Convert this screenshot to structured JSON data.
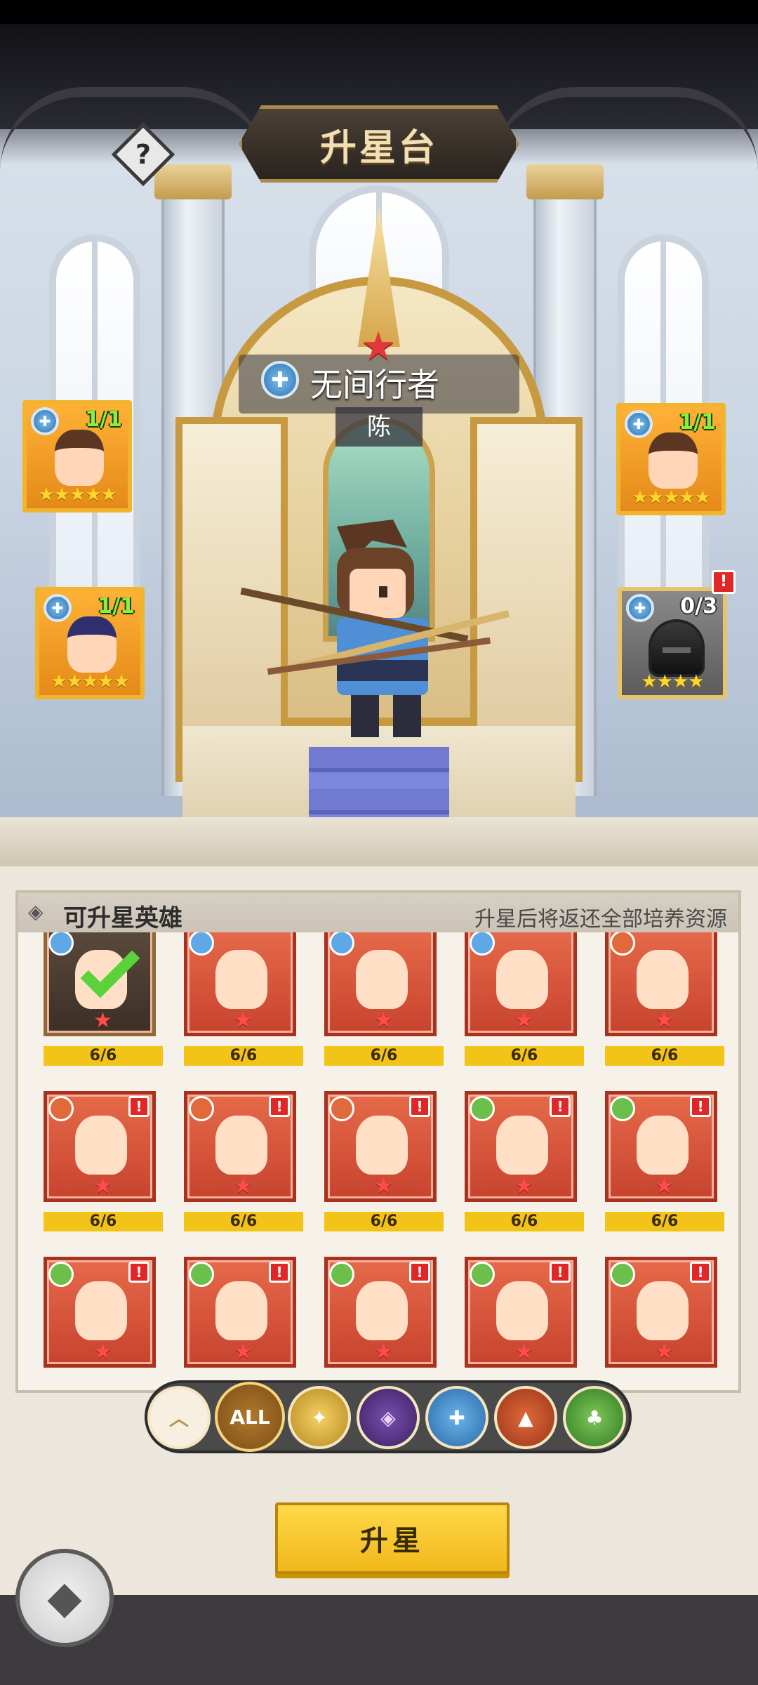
{
  "header": {
    "title": "升星台",
    "help_label": "?"
  },
  "hero": {
    "name": "无间行者",
    "subtitle": "陈",
    "faction_icon": "blue-shield-faction-icon"
  },
  "slots": [
    {
      "count": "1/1",
      "stars": "★★★★★"
    },
    {
      "count": "1/1",
      "stars": "★★★★★"
    },
    {
      "count": "1/1",
      "stars": "★★★★★"
    },
    {
      "count": "0/3",
      "stars": "★★★★",
      "alert": "!"
    }
  ],
  "list": {
    "title": "可升星英雄",
    "note": "升星后将返还全部培养资源",
    "heroes": [
      {
        "progress": "6/6",
        "selected": true
      },
      {
        "progress": "6/6"
      },
      {
        "progress": "6/6"
      },
      {
        "progress": "6/6"
      },
      {
        "progress": "6/6"
      },
      {
        "progress": "6/6",
        "alert": "!"
      },
      {
        "progress": "6/6",
        "alert": "!"
      },
      {
        "progress": "6/6",
        "alert": "!"
      },
      {
        "progress": "6/6",
        "alert": "!"
      },
      {
        "progress": "6/6",
        "alert": "!"
      },
      {
        "progress": "",
        "alert": "!"
      },
      {
        "progress": "",
        "alert": "!"
      },
      {
        "progress": "",
        "alert": "!"
      },
      {
        "progress": "",
        "alert": "!"
      },
      {
        "progress": "",
        "alert": "!"
      }
    ]
  },
  "filters": {
    "collapse": "︿",
    "all": "ALL",
    "gold": "✦",
    "purple": "◈",
    "blue": "✚",
    "red": "▲",
    "green": "♣"
  },
  "actions": {
    "upgrade": "升星",
    "back": "◆"
  },
  "colors": {
    "accent": "#f2c418",
    "card_red": "#c7432e",
    "slot_gold": "#f2b42c"
  }
}
